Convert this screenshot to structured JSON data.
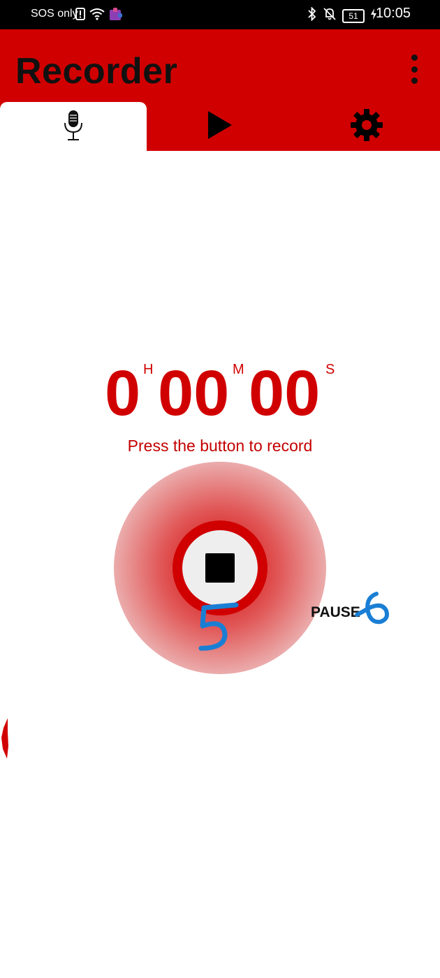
{
  "status_bar": {
    "carrier": "SOS only",
    "battery": "51",
    "time": "10:05"
  },
  "app": {
    "title": "Recorder"
  },
  "tabs": [
    {
      "icon": "microphone-icon",
      "active": true
    },
    {
      "icon": "play-icon",
      "active": false
    },
    {
      "icon": "gear-icon",
      "active": false
    }
  ],
  "timer": {
    "hours": "0",
    "hours_unit": "H",
    "minutes": "00",
    "minutes_unit": "M",
    "seconds": "00",
    "seconds_unit": "S"
  },
  "hint": "Press the button to record",
  "controls": {
    "pause_label": "PAUSE"
  },
  "annotations": {
    "mark_5": "5",
    "mark_6": "6"
  },
  "colors": {
    "accent": "#d10000",
    "annotation": "#1a7fd4"
  }
}
